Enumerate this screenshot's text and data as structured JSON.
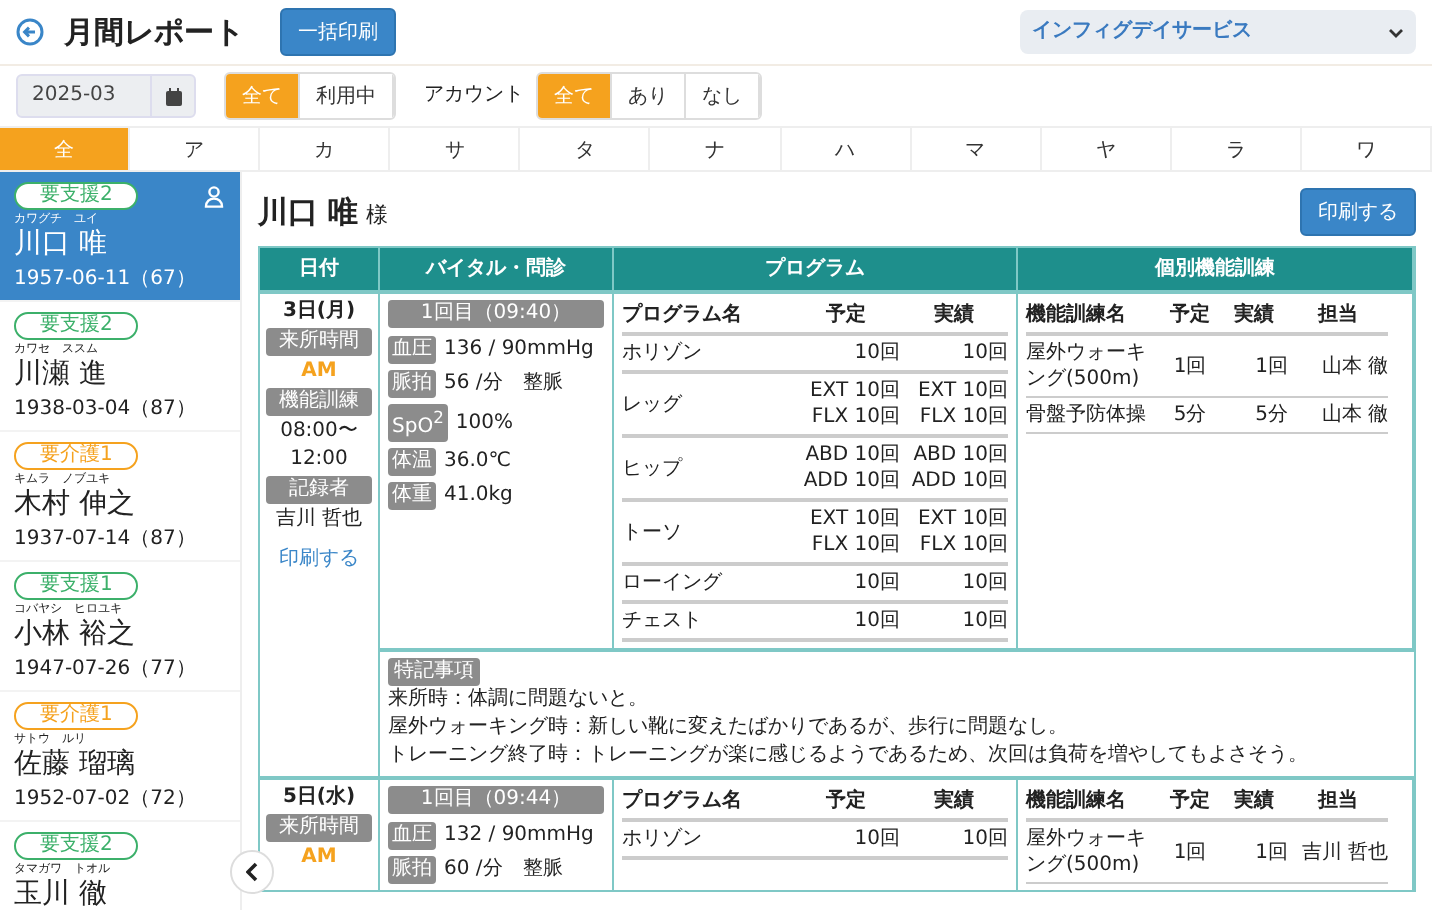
{
  "header": {
    "title": "月間レポート",
    "bulk_print_button": "一括印刷",
    "facility_select": "インフィグデイサービス"
  },
  "filters": {
    "month": "2025-03",
    "usage": [
      {
        "label": "全て",
        "selected": true
      },
      {
        "label": "利用中",
        "selected": false
      }
    ],
    "account_label": "アカウント",
    "account": [
      {
        "label": "全て",
        "selected": true
      },
      {
        "label": "あり",
        "selected": false
      },
      {
        "label": "なし",
        "selected": false
      }
    ]
  },
  "kana_tabs": [
    {
      "label": "全",
      "selected": true
    },
    {
      "label": "ア",
      "selected": false
    },
    {
      "label": "カ",
      "selected": false
    },
    {
      "label": "サ",
      "selected": false
    },
    {
      "label": "タ",
      "selected": false
    },
    {
      "label": "ナ",
      "selected": false
    },
    {
      "label": "ハ",
      "selected": false
    },
    {
      "label": "マ",
      "selected": false
    },
    {
      "label": "ヤ",
      "selected": false
    },
    {
      "label": "ラ",
      "selected": false
    },
    {
      "label": "ワ",
      "selected": false
    }
  ],
  "patients": [
    {
      "care_level": "要支援2",
      "color": "#3cb06a",
      "kana": "カワグチ　ユイ",
      "name": "川口 唯",
      "birth": "1957-06-11（67）",
      "selected": true
    },
    {
      "care_level": "要支援2",
      "color": "#3cb06a",
      "kana": "カワセ　ススム",
      "name": "川瀬 進",
      "birth": "1938-03-04（87）",
      "selected": false
    },
    {
      "care_level": "要介護1",
      "color": "#f5a21e",
      "kana": "キムラ　ノブユキ",
      "name": "木村 伸之",
      "birth": "1937-07-14（87）",
      "selected": false
    },
    {
      "care_level": "要支援1",
      "color": "#3cb06a",
      "kana": "コバヤシ　ヒロユキ",
      "name": "小林 裕之",
      "birth": "1947-07-26（77）",
      "selected": false
    },
    {
      "care_level": "要介護1",
      "color": "#f5a21e",
      "kana": "サトウ　ルリ",
      "name": "佐藤 瑠璃",
      "birth": "1952-07-02（72）",
      "selected": false
    },
    {
      "care_level": "要支援2",
      "color": "#3cb06a",
      "kana": "タマガワ　トオル",
      "name": "玉川 徹",
      "selected": false
    }
  ],
  "report": {
    "name": "川口 唯",
    "honorific": "様",
    "print_button": "印刷する",
    "columns": [
      "日付",
      "バイタル・問診",
      "プログラム",
      "個別機能訓練"
    ],
    "days": [
      {
        "date": "3日(月)",
        "visit_label": "来所時間",
        "visit": "AM",
        "training_label": "機能訓練",
        "time_from": "08:00〜",
        "time_to": "12:00",
        "recorder_label": "記録者",
        "recorder": "吉川 哲也",
        "print_link": "印刷する",
        "vitals": {
          "session": "1回目（09:40）",
          "items": [
            {
              "label": "血圧",
              "value": "136 / 90mmHg"
            },
            {
              "label": "脈拍",
              "value": "56 /分　整脈"
            },
            {
              "label": "SpO$^{2}$",
              "value": "100%"
            },
            {
              "label": "体温",
              "value": "36.0℃"
            },
            {
              "label": "体重",
              "value": "41.0kg"
            }
          ]
        },
        "program": {
          "headers": [
            "プログラム名",
            "予定",
            "実績"
          ],
          "rows": [
            {
              "name": "ホリゾン",
              "plan": [
                "10回"
              ],
              "actual": [
                "10回"
              ]
            },
            {
              "name": "レッグ",
              "plan": [
                "EXT 10回",
                "FLX 10回"
              ],
              "actual": [
                "EXT 10回",
                "FLX 10回"
              ]
            },
            {
              "name": "ヒップ",
              "plan": [
                "ABD 10回",
                "ADD 10回"
              ],
              "actual": [
                "ABD 10回",
                "ADD 10回"
              ]
            },
            {
              "name": "トーソ",
              "plan": [
                "EXT 10回",
                "FLX 10回"
              ],
              "actual": [
                "EXT 10回",
                "FLX 10回"
              ]
            },
            {
              "name": "ローイング",
              "plan": [
                "10回"
              ],
              "actual": [
                "10回"
              ]
            },
            {
              "name": "チェスト",
              "plan": [
                "10回"
              ],
              "actual": [
                "10回"
              ]
            }
          ]
        },
        "training": {
          "headers": [
            "機能訓練名",
            "予定",
            "実績",
            "担当"
          ],
          "rows": [
            {
              "name": "屋外ウォーキング(500m)",
              "plan": "1回",
              "actual": "1回",
              "staff": "山本 徹"
            },
            {
              "name": "骨盤予防体操",
              "plan": "5分",
              "actual": "5分",
              "staff": "山本 徹"
            }
          ]
        },
        "notes_label": "特記事項",
        "notes": [
          "来所時：体調に問題ないと。",
          "屋外ウォーキング時：新しい靴に変えたばかりであるが、歩行に問題なし。",
          "トレーニング終了時：トレーニングが楽に感じるようであるため、次回は負荷を増やしてもよさそう。"
        ]
      },
      {
        "date": "5日(水)",
        "visit_label": "来所時間",
        "visit": "AM",
        "vitals": {
          "session": "1回目（09:44）",
          "items": [
            {
              "label": "血圧",
              "value": "132 / 90mmHg"
            },
            {
              "label": "脈拍",
              "value": "60 /分　整脈"
            }
          ]
        },
        "program": {
          "headers": [
            "プログラム名",
            "予定",
            "実績"
          ],
          "rows": [
            {
              "name": "ホリゾン",
              "plan": [
                "10回"
              ],
              "actual": [
                "10回"
              ]
            }
          ]
        },
        "training": {
          "headers": [
            "機能訓練名",
            "予定",
            "実績",
            "担当"
          ],
          "rows": [
            {
              "name": "屋外ウォーキング(500m)",
              "plan": "1回",
              "actual": "1回",
              "staff": "吉川 哲也"
            }
          ]
        }
      }
    ]
  }
}
